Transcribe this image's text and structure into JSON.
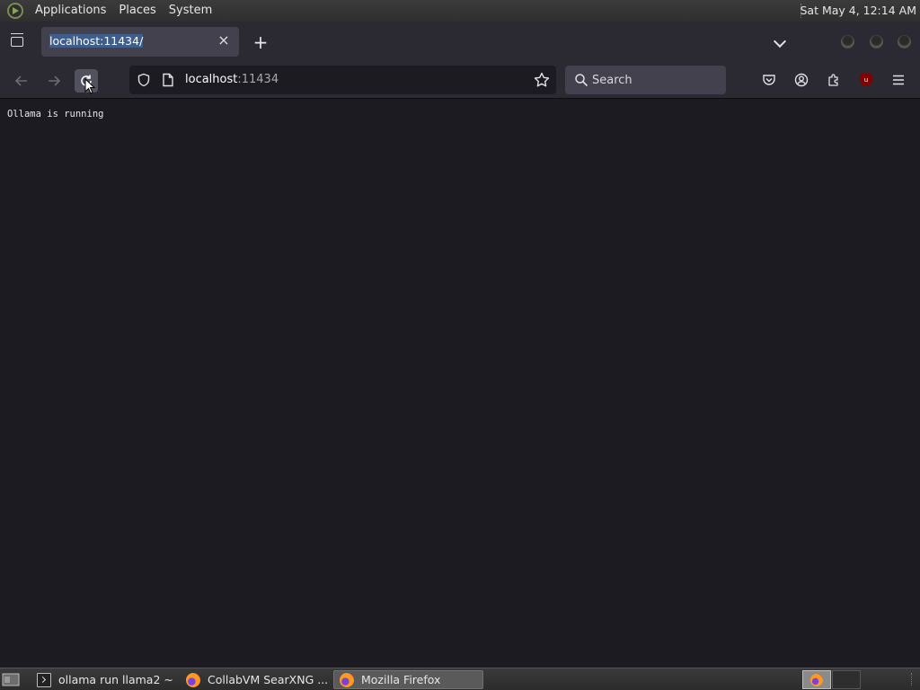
{
  "system_panel": {
    "menus": [
      "Applications",
      "Places",
      "System"
    ],
    "clock": "Sat May  4, 12:14 AM"
  },
  "browser": {
    "tab": {
      "title": "localhost:11434/"
    },
    "url_host": "localhost",
    "url_port": ":11434",
    "search_placeholder": "Search"
  },
  "page": {
    "body_text": "Ollama is running"
  },
  "taskbar": {
    "tasks": [
      {
        "label": "ollama run llama2 ~",
        "icon": "terminal-icon",
        "active": false
      },
      {
        "label": "CollabVM SearXNG ...",
        "icon": "firefox-icon",
        "active": false
      },
      {
        "label": "Mozilla Firefox",
        "icon": "firefox-icon",
        "active": true
      }
    ]
  },
  "colors": {
    "page_bg": "#1c1b22",
    "toolbar_bg": "#2b2a33",
    "selected_tab": "#42414d",
    "ublock_red": "#800000"
  }
}
